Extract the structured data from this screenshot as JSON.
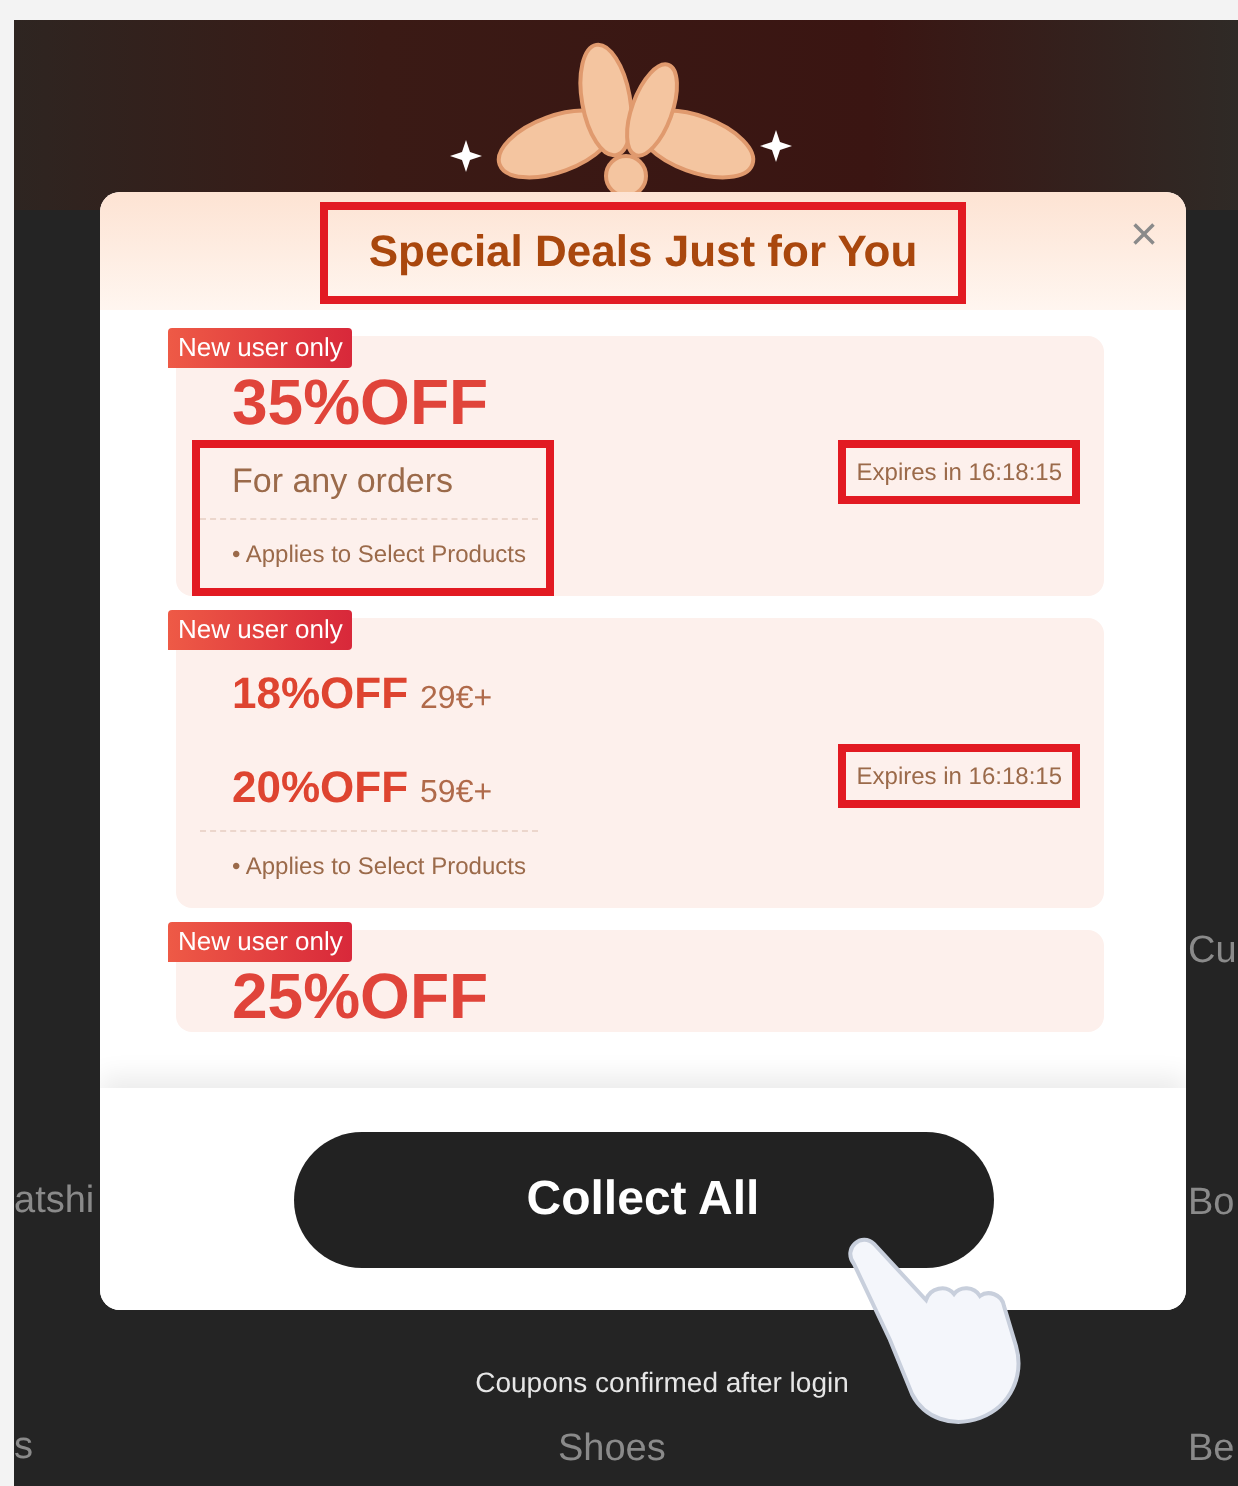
{
  "background_page": {
    "labels": [
      {
        "text": "Cu"
      },
      {
        "text": "atshi"
      },
      {
        "text": "Bo"
      },
      {
        "text": "s"
      },
      {
        "text": "Shoes"
      },
      {
        "text": "Be"
      }
    ]
  },
  "dialog": {
    "title": "Special Deals Just for You",
    "title_highlighted": true,
    "close": "×",
    "coupons": [
      {
        "kind": "single",
        "tag": "New user only",
        "tiers": [
          {
            "discount": "35%OFF"
          }
        ],
        "condition": "For any orders",
        "note": "• Applies to Select Products",
        "details_highlighted": true,
        "expiry": "Expires in 16:18:15",
        "expiry_highlighted": true
      },
      {
        "kind": "tiered",
        "tag": "New user only",
        "tiers": [
          {
            "discount": "18%OFF",
            "threshold": "29€+"
          },
          {
            "discount": "20%OFF",
            "threshold": "59€+"
          }
        ],
        "note": "• Applies to Select Products",
        "details_highlighted": false,
        "expiry": "Expires in 16:18:15",
        "expiry_highlighted": true
      },
      {
        "kind": "single",
        "tag": "New user only",
        "tiers": [
          {
            "discount": "25%OFF"
          }
        ]
      }
    ],
    "button": "Collect All",
    "footnote": "Coupons confirmed after login"
  }
}
